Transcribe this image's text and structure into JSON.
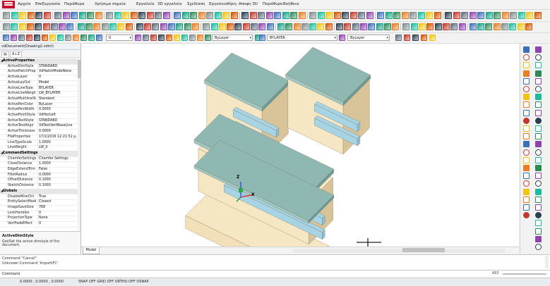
{
  "menu": [
    "Αρχείο",
    "Επεξεργασία",
    "Παράθυρα",
    "Χρήσιμα σημεία",
    "Εργαλεία",
    "3D εργαλεία",
    "Σχεδίαση",
    "Εργαλειοθήκη",
    "Αποψη 3D",
    "Παράθυρο",
    "Βοήθεια"
  ],
  "layers": {
    "layer_value": "0",
    "color_value": "ByLayer",
    "linetype_value": "BYLAYER",
    "lineweight_value": "ByLayer"
  },
  "properties": {
    "document_title": "vdDocument(Drawing2.vdml)",
    "tabs": [
      "▤",
      "A↓Z"
    ],
    "rows": [
      {
        "type": "cat",
        "key": "ActiveProperties"
      },
      {
        "key": "ActiveDimStyle",
        "value": "STANDARD"
      },
      {
        "key": "ActiveHatchProp",
        "value": "VdHatchModeNone"
      },
      {
        "key": "ActiveLayer",
        "value": "0"
      },
      {
        "key": "ActiveLayOut",
        "value": "Model"
      },
      {
        "key": "ActiveLineType",
        "value": "BYLAYER"
      },
      {
        "key": "ActiveLineWeight",
        "value": "LW_BYLAYER"
      },
      {
        "key": "ActiveMultilineSt",
        "value": "Standard"
      },
      {
        "key": "ActivePenColor",
        "value": "ByLayer"
      },
      {
        "key": "ActivePenWidth",
        "value": "0.0000"
      },
      {
        "key": "ActivePointStyle",
        "value": "VdHorLeft"
      },
      {
        "key": "ActiveTextStyle",
        "value": "STANDARD"
      },
      {
        "key": "ActiveTextAlign",
        "value": "VdTextVertBaseLine"
      },
      {
        "key": "ActiveThickness",
        "value": "0.0000"
      },
      {
        "key": "FileProperties",
        "value": "17/2/2016 12:21:52 μ."
      },
      {
        "key": "LineTypeScale",
        "value": "1.0000"
      },
      {
        "key": "LineWeight",
        "value": "LW_0"
      },
      {
        "type": "cat",
        "key": "CommandSettings"
      },
      {
        "key": "ChamferSettings",
        "value": "Chamfer Settings"
      },
      {
        "key": "CloseDistance",
        "value": "1.0000"
      },
      {
        "key": "EdgeExtendTrim",
        "value": "False"
      },
      {
        "key": "FilletRadius",
        "value": "0.0000"
      },
      {
        "key": "OffsetDistance",
        "value": "0.1000"
      },
      {
        "key": "SketchDistance",
        "value": "0.1000"
      },
      {
        "type": "cat",
        "key": "Globals"
      },
      {
        "key": "DisableWireCtrl",
        "value": "True"
      },
      {
        "key": "EntitySelectMode",
        "value": "Closest"
      },
      {
        "key": "ImageSaveSize",
        "value": "768"
      },
      {
        "key": "LockHandles",
        "value": "0"
      },
      {
        "key": "ProjectionType",
        "value": "None"
      },
      {
        "key": "VertFadeEffect",
        "value": "0"
      }
    ],
    "desc_title": "ActiveDimStyle",
    "desc_text": "Get/Set the active dimstyle of the document."
  },
  "canvas": {
    "axis_z": "Z",
    "axis_x": "X"
  },
  "tabs": {
    "model": "Model"
  },
  "history": [
    "Command \"Cancel\"",
    "Unknown Command 'ImportIFC'"
  ],
  "command": {
    "label": "Command:",
    "right_value": "A93"
  },
  "status": {
    "coords": "0.0000 , 0.0000 , 0.0000",
    "toggles": "SNAP OFF   GRID OFF   ORTHO OFF   OSNAP"
  },
  "colors": {
    "wall": "#f5e6c4",
    "wall_dark": "#d9c49a",
    "roof": "#8fb8b3",
    "roof_dark": "#6d9a96",
    "glass": "#a7d4e4"
  }
}
